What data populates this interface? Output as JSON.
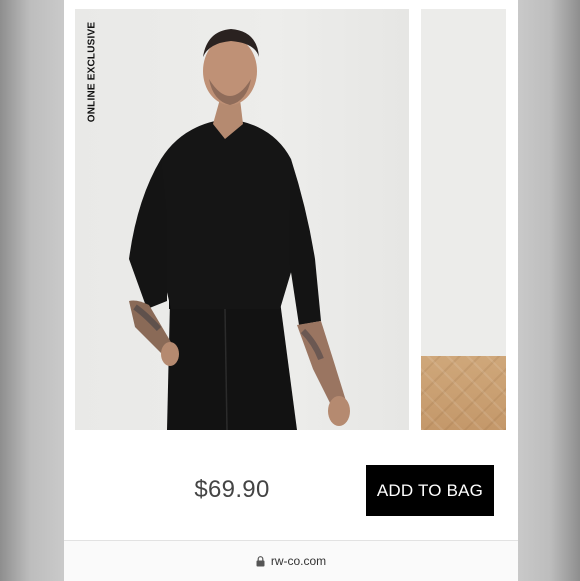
{
  "product": {
    "badge": "ONLINE EXCLUSIVE",
    "price": "$69.90",
    "add_to_bag_label": "ADD TO BAG"
  },
  "browser": {
    "url": "rw-co.com",
    "lock_icon": "lock-icon"
  },
  "colors": {
    "button_bg": "#000000",
    "button_text": "#ffffff",
    "price_text": "#444444",
    "page_bg": "#ffffff"
  }
}
